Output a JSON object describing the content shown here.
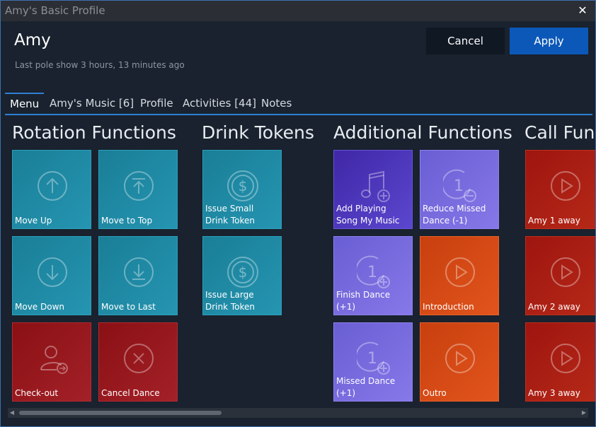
{
  "window": {
    "title": "Amy's Basic Profile",
    "close_glyph": "✕"
  },
  "header": {
    "name": "Amy",
    "subtitle": "Last pole show 3 hours, 13 minutes ago",
    "cancel_label": "Cancel",
    "apply_label": "Apply"
  },
  "tabs": [
    {
      "label": "Menu",
      "active": true
    },
    {
      "label": "Amy's Music [6]"
    },
    {
      "label": "Profile"
    },
    {
      "label": "Activities [44]"
    },
    {
      "label": "Notes"
    }
  ],
  "sections": {
    "rotation": "Rotation Functions",
    "drink": "Drink Tokens",
    "additional": "Additional Functions",
    "call": "Call Fun"
  },
  "tiles": {
    "move_up": {
      "label": "Move Up",
      "icon": "arrow-up-circle-icon"
    },
    "move_to_top": {
      "label": "Move to Top",
      "icon": "arrow-to-top-circle-icon"
    },
    "move_down": {
      "label": "Move Down",
      "icon": "arrow-down-circle-icon"
    },
    "move_to_last": {
      "label": "Move to Last",
      "icon": "arrow-to-bottom-circle-icon"
    },
    "check_out": {
      "label": "Check-out",
      "icon": "user-checkout-icon"
    },
    "cancel_dance": {
      "label": "Cancel Dance",
      "icon": "x-circle-icon"
    },
    "issue_small": {
      "label": "Issue Small Drink Token",
      "icon": "dollar-coin-icon"
    },
    "issue_large": {
      "label": "Issue Large Drink Token",
      "icon": "dollar-coin-icon"
    },
    "add_playing_song": {
      "label": "Add Playing Song My Music",
      "icon": "music-note-add-icon"
    },
    "reduce_missed": {
      "label": "Reduce Missed Dance (-1)",
      "icon": "one-minus-icon",
      "icon_digit": "1"
    },
    "finish_dance": {
      "label": "Finish Dance (+1)",
      "icon": "one-plus-icon",
      "icon_digit": "1"
    },
    "introduction": {
      "label": "Introduction",
      "icon": "play-circle-icon"
    },
    "missed_dance": {
      "label": "Missed Dance (+1)",
      "icon": "one-plus-icon",
      "icon_digit": "1"
    },
    "outro": {
      "label": "Outro",
      "icon": "play-circle-icon"
    },
    "call_1": {
      "label": "Amy 1 away",
      "icon": "play-circle-icon"
    },
    "call_2": {
      "label": "Amy 2 away",
      "icon": "play-circle-icon"
    },
    "call_3": {
      "label": "Amy 3 away",
      "icon": "play-circle-icon"
    }
  },
  "scrollbar": {
    "left_arrow": "◀",
    "right_arrow": "▶"
  },
  "colors": {
    "accent": "#2f7fd6",
    "apply": "#0c58b8",
    "teal": "#2595b2",
    "red": "#a32128",
    "indigo": "#5b47cf",
    "lavender": "#8678e8",
    "orange": "#e2541c"
  }
}
